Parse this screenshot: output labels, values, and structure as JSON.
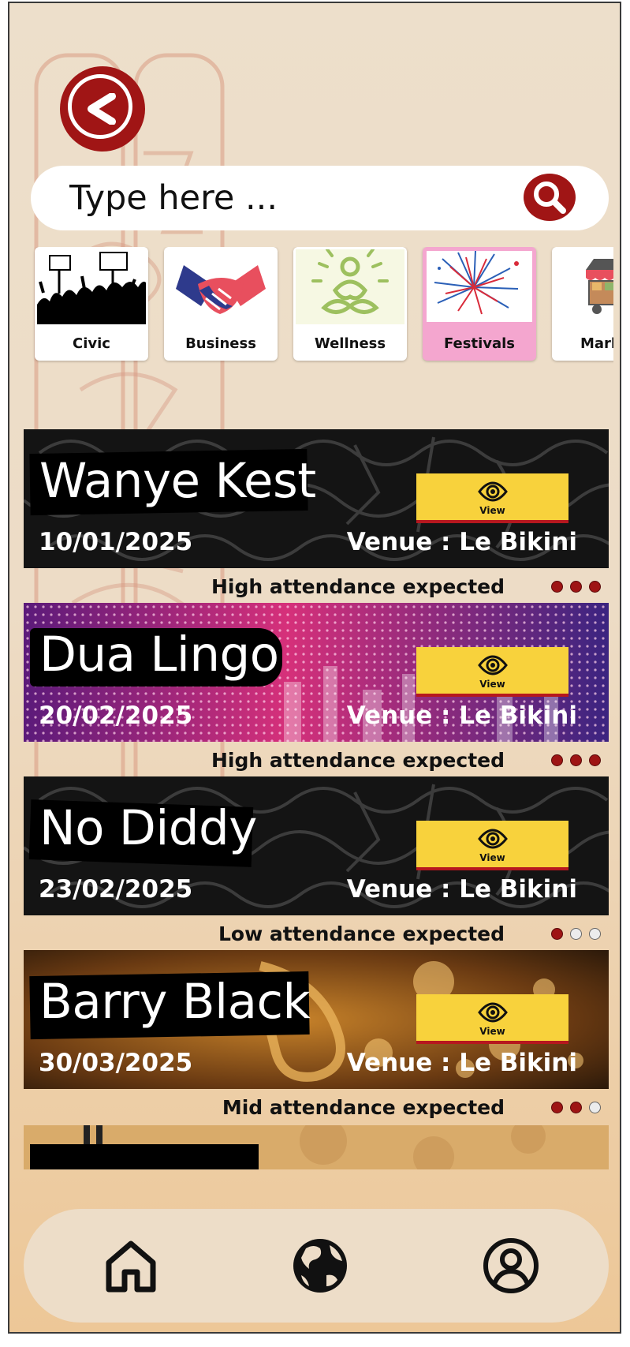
{
  "search": {
    "placeholder": "Type here ..."
  },
  "categories": [
    {
      "label": "Civic",
      "icon": "protest-crowd-icon",
      "active": false
    },
    {
      "label": "Business",
      "icon": "handshake-icon",
      "active": false
    },
    {
      "label": "Wellness",
      "icon": "meditation-icon",
      "active": false
    },
    {
      "label": "Festivals",
      "icon": "fireworks-icon",
      "active": true
    },
    {
      "label": "Mark",
      "icon": "market-stall-icon",
      "active": false
    }
  ],
  "events": [
    {
      "title": "Wanye Kest",
      "date": "10/01/2025",
      "venue": "Venue : Le Bikini",
      "view_label": "View",
      "attendance": "High attendance expected",
      "level": 3,
      "bg": "graffiti"
    },
    {
      "title": "Dua Lingo",
      "date": "20/02/2025",
      "venue": "Venue : Le Bikini",
      "view_label": "View",
      "attendance": "High attendance expected",
      "level": 3,
      "bg": "neon"
    },
    {
      "title": "No Diddy",
      "date": "23/02/2025",
      "venue": "Venue : Le Bikini",
      "view_label": "View",
      "attendance": "Low attendance expected",
      "level": 1,
      "bg": "graffiti"
    },
    {
      "title": "Barry Black",
      "date": "30/03/2025",
      "venue": "Venue : Le Bikini",
      "view_label": "View",
      "attendance": "Mid attendance expected",
      "level": 2,
      "bg": "sax"
    }
  ],
  "attendance_max": 3,
  "nav": [
    {
      "name": "home",
      "icon": "home-icon"
    },
    {
      "name": "globe",
      "icon": "globe-icon"
    },
    {
      "name": "profile",
      "icon": "user-profile-icon"
    }
  ],
  "colors": {
    "accent": "#a01515",
    "view_button": "#f8d23c",
    "festival_active": "#f4a6cf"
  }
}
